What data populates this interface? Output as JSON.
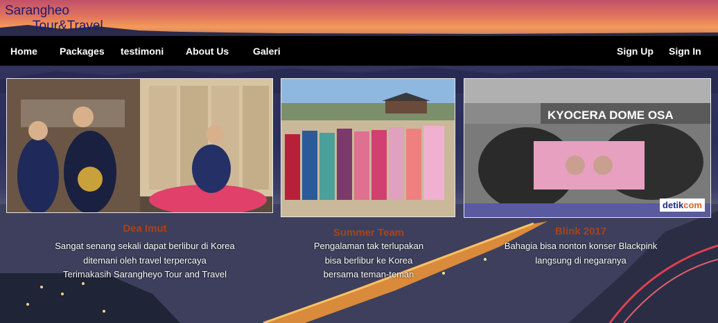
{
  "brand": {
    "line1": "Sarangheo",
    "line2": "Tour&Travel"
  },
  "nav": {
    "left": [
      "Home",
      "Packages",
      "testimoni",
      "About Us",
      "Galeri"
    ],
    "right": [
      "Sign Up",
      "Sign In"
    ]
  },
  "colors": {
    "brand": "#1e1a6e",
    "nav_bg": "#000000",
    "caption_title": "#a8431c"
  },
  "testimonials": [
    {
      "title": "Dea Imut",
      "lines": [
        "Sangat senang sekali dapat berlibur di Korea",
        "ditemani oleh travel terpercaya",
        "Terimakasih Sarangheyo Tour and Travel"
      ]
    },
    {
      "title": "Summer Team",
      "lines": [
        "Pengalaman tak terlupakan",
        "bisa berlibur ke Korea",
        "bersama teman-teman"
      ]
    },
    {
      "title": "Blink 2017",
      "lines": [
        "Bahagia bisa nonton konser Blackpink",
        "langsung di negaranya"
      ]
    }
  ],
  "photo_texts": {
    "venue_sign": "KYOCERA DOME OSA",
    "watermark_a": "detik",
    "watermark_b": "com"
  }
}
